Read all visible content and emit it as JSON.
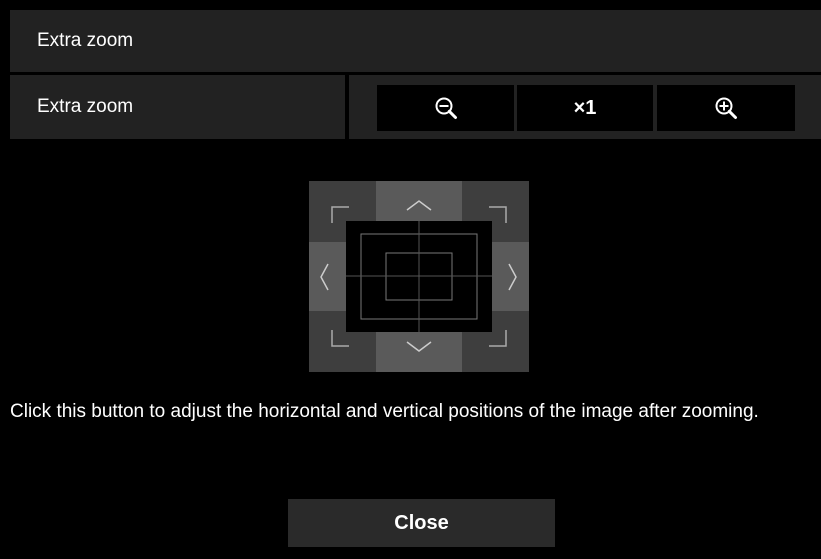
{
  "dialog": {
    "title": "Extra zoom",
    "row_label": "Extra zoom",
    "controls": {
      "zoom_out_icon": "zoom-out-magnifier-icon",
      "magnification": "×1",
      "zoom_in_icon": "zoom-in-magnifier-icon"
    },
    "position_pad": {
      "icons": [
        "arrow-up",
        "arrow-down",
        "arrow-left",
        "arrow-right",
        "corner-top-left",
        "corner-top-right",
        "corner-bottom-left",
        "corner-bottom-right"
      ]
    },
    "description": "Click this button to adjust the horizontal and vertical positions of the image after zooming.",
    "close_label": "Close"
  },
  "colors": {
    "background": "#000000",
    "panel": "#222222",
    "pad_edge": "#5a5a5a",
    "pad_corner": "#3e3e3e",
    "text": "#ffffff"
  }
}
